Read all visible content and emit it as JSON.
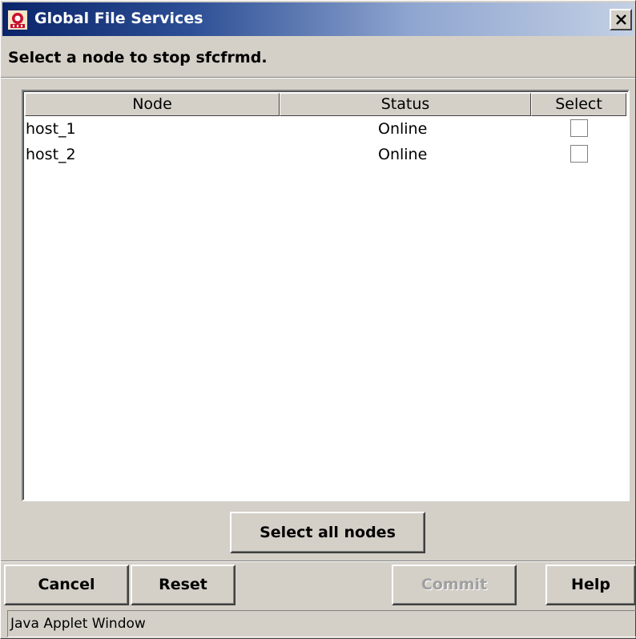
{
  "window": {
    "title": "Global File Services",
    "icon": "gfs-app-icon",
    "close_icon": "close-icon"
  },
  "instruction": "Select a node to stop sfcfrmd.",
  "table": {
    "columns": [
      "Node",
      "Status",
      "Select"
    ],
    "rows": [
      {
        "node": "host_1",
        "status": "Online",
        "selected": false
      },
      {
        "node": "host_2",
        "status": "Online",
        "selected": false
      }
    ]
  },
  "buttons": {
    "select_all": "Select all nodes",
    "cancel": "Cancel",
    "reset": "Reset",
    "commit": "Commit",
    "help": "Help"
  },
  "status_bar": "Java Applet Window"
}
